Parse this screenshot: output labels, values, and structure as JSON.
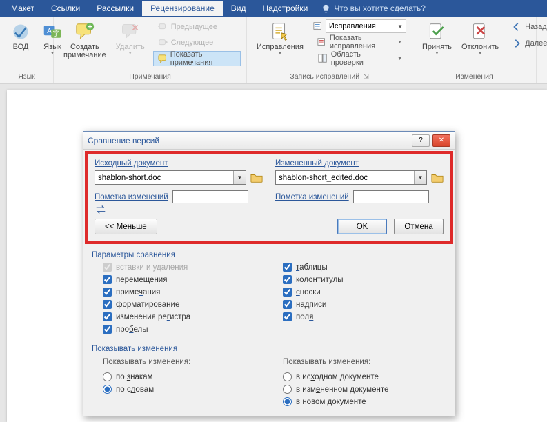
{
  "colors": {
    "brand": "#2b579a",
    "highlight": "#de2a2a"
  },
  "tabs": {
    "maket": "Макет",
    "ssylki": "Ссылки",
    "rassylki": "Рассылки",
    "recenz": "Рецензирование",
    "vid": "Вид",
    "nadstroiki": "Надстройки",
    "search": "Что вы хотите сделать?"
  },
  "ribbon": {
    "yazyk_group": "Язык",
    "vod": "ВОД",
    "yazyk": "Язык",
    "prim_group": "Примечания",
    "sozdat_prim": "Создать\nпримечание",
    "udalit": "Удалить",
    "pred": "Предыдущее",
    "sled": "Следующее",
    "pokazat_prim": "Показать примечания",
    "zapis_group": "Запись исправлений",
    "ispravleniya_btn": "Исправления",
    "ispravleniya_combo": "Исправления",
    "pokazat_ispr": "Показать исправления",
    "oblast_prov": "Область проверки",
    "izmeneniya_group": "Изменения",
    "prinyat": "Принять",
    "otklonit": "Отклонить",
    "nazad": "Назад",
    "dalee": "Далее"
  },
  "dialog": {
    "title": "Сравнение версий",
    "source_label": "Исходный документ",
    "source_file": "shablon-short.doc",
    "changed_label": "Измененный документ",
    "changed_file": "shablon-short_edited.doc",
    "mark_label": "Пометка изменений",
    "mark_value_src": "",
    "mark_value_dst": "",
    "less": "<< Меньше",
    "ok": "OK",
    "cancel": "Отмена",
    "params_title": "Параметры сравнения",
    "opts": {
      "vstavki": "вставки и удаления",
      "peremesh": "перемещения",
      "primech": "примечания",
      "format": "форматирование",
      "registr": "изменения регистра",
      "probely": "пробелы",
      "tablicy": "таблицы",
      "kolontituly": "колонтитулы",
      "snoski": "сноски",
      "nadpisi": "надписи",
      "polya": "поля"
    },
    "show_title": "Показывать изменения",
    "show_in_label": "Показывать изменения:",
    "radio": {
      "znakam": "по знакам",
      "slovam": "по словам",
      "ishod": "в исходном документе",
      "izmen": "в измененном документе",
      "novom": "в новом документе"
    }
  }
}
